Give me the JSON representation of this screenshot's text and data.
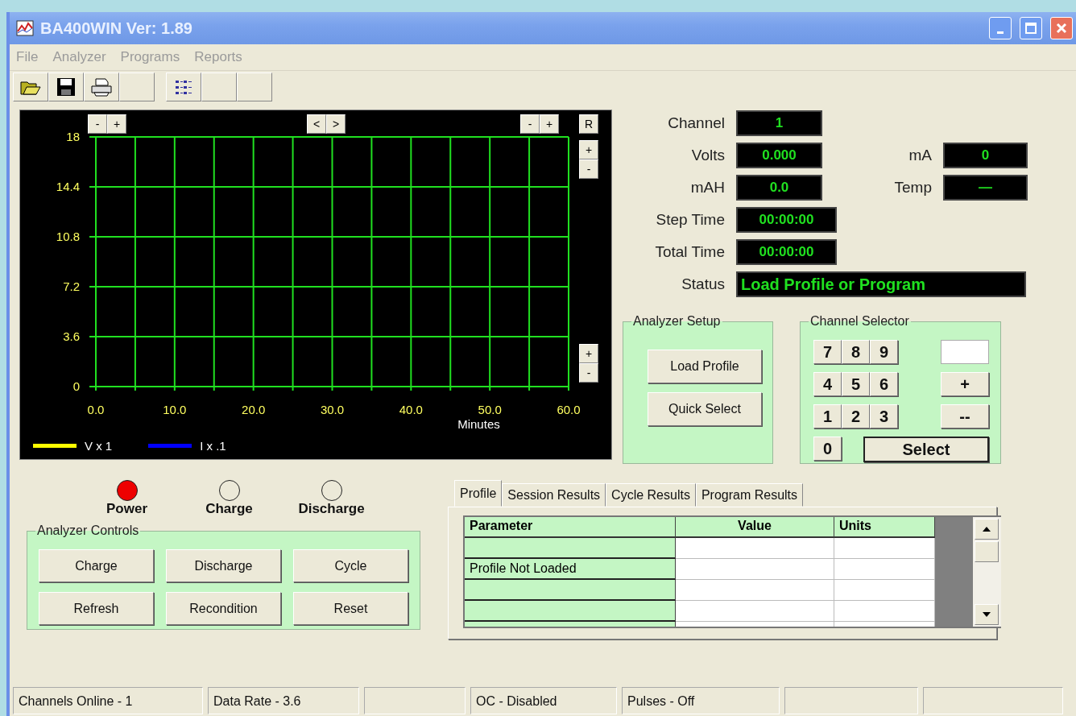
{
  "window": {
    "title": "BA400WIN Ver: 1.89"
  },
  "menu": [
    "File",
    "Analyzer",
    "Programs",
    "Reports"
  ],
  "toolbar": [
    {
      "kind": "open"
    },
    {
      "kind": "save"
    },
    {
      "kind": "print"
    },
    {
      "kind": "empty"
    },
    {
      "kind": "list"
    },
    {
      "kind": "empty"
    },
    {
      "kind": "empty"
    }
  ],
  "chart": {
    "controls": {
      "top_left": [
        "-",
        "+"
      ],
      "top_center": [
        "<",
        ">"
      ],
      "top_right": [
        "-",
        "+"
      ],
      "reset": "R",
      "right_upper": [
        "+",
        "-"
      ],
      "right_lower": [
        "+",
        "-"
      ]
    },
    "chart_data": {
      "type": "line",
      "xlabel": "Minutes",
      "ylim": [
        0,
        18
      ],
      "grid": true,
      "categories": [
        "0.0",
        "10.0",
        "20.0",
        "30.0",
        "40.0",
        "50.0",
        "60.0"
      ],
      "yticks": [
        0,
        3.6,
        7.2,
        10.8,
        14.4,
        18
      ],
      "series": [
        {
          "name": "V x 1",
          "color": "#ffff00",
          "values": [
            null,
            null,
            null,
            null,
            null,
            null,
            null
          ]
        },
        {
          "name": "I x .1",
          "color": "#0000ff",
          "values": [
            null,
            null,
            null,
            null,
            null,
            null,
            null
          ]
        }
      ]
    }
  },
  "readouts": [
    [
      {
        "label": "Channel",
        "value": "1"
      }
    ],
    [
      {
        "label": "Volts",
        "value": "0.000"
      },
      {
        "label": "mA",
        "value": "0"
      }
    ],
    [
      {
        "label": "mAH",
        "value": "0.0"
      },
      {
        "label": "Temp",
        "value": "—"
      }
    ],
    [
      {
        "label": "Step Time",
        "value": "00:00:00",
        "kind": "time"
      }
    ],
    [
      {
        "label": "Total Time",
        "value": "00:00:00",
        "kind": "time"
      }
    ],
    [
      {
        "label": "Status",
        "value": "Load Profile or Program",
        "kind": "status"
      }
    ]
  ],
  "analyzer_setup": {
    "title": "Analyzer Setup",
    "buttons": [
      "Load Profile",
      "Quick Select"
    ]
  },
  "channel_selector": {
    "title": "Channel Selector",
    "keys": [
      [
        "7",
        "8",
        "9"
      ],
      [
        "4",
        "5",
        "6"
      ],
      [
        "1",
        "2",
        "3"
      ]
    ],
    "zero": "0",
    "plus": "+",
    "minus": "--",
    "select": "Select"
  },
  "indicators": [
    {
      "label": "Power",
      "on": true
    },
    {
      "label": "Charge",
      "on": false
    },
    {
      "label": "Discharge",
      "on": false
    }
  ],
  "analyzer_controls": {
    "title": "Analyzer Controls",
    "buttons": [
      "Charge",
      "Discharge",
      "Cycle",
      "Refresh",
      "Recondition",
      "Reset"
    ]
  },
  "tabs": [
    {
      "label": "Profile",
      "selected": true
    },
    {
      "label": "Session Results",
      "selected": false
    },
    {
      "label": "Cycle Results",
      "selected": false
    },
    {
      "label": "Program Results",
      "selected": false
    }
  ],
  "table": {
    "columns": [
      "Parameter",
      "Value",
      "Units"
    ],
    "rows": [
      {},
      {
        "parameter": "Profile Not Loaded"
      },
      {},
      {},
      {}
    ]
  },
  "status_bar": [
    {
      "kind": "text",
      "text": "Channels Online -  1"
    },
    {
      "kind": "text",
      "text": "Data Rate - 3.6"
    },
    {
      "kind": "blank"
    },
    {
      "kind": "text",
      "text": "OC - Disabled"
    },
    {
      "kind": "text",
      "text": "Pulses - Off"
    },
    {
      "kind": "blank"
    },
    {
      "kind": "blank"
    }
  ]
}
